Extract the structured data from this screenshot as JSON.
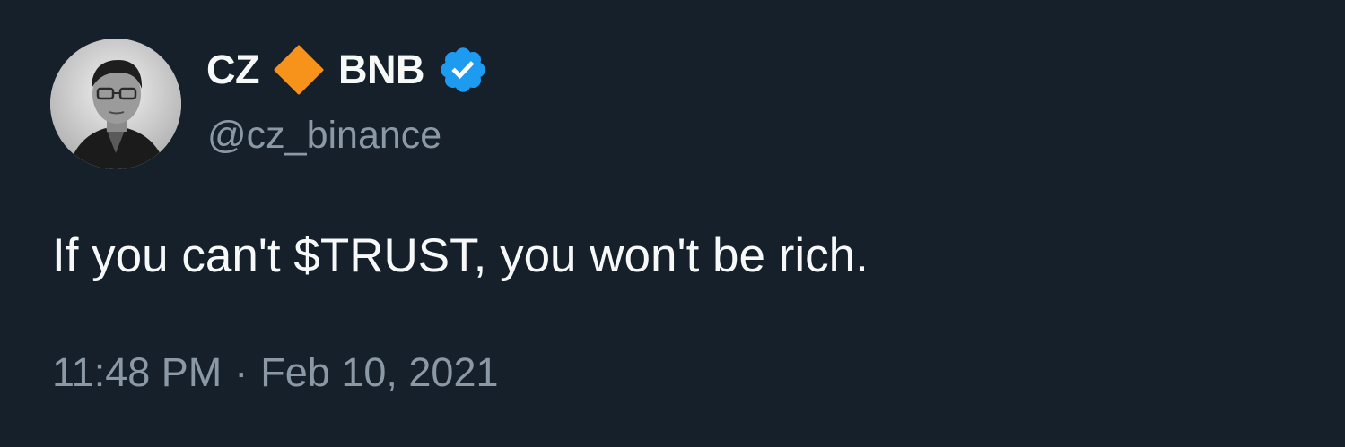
{
  "tweet": {
    "author": {
      "display_name_prefix": "CZ",
      "display_name_suffix": "BNB",
      "handle": "@cz_binance",
      "avatar_icon": "profile-photo",
      "name_emoji_icon": "orange-diamond-icon",
      "verified_icon": "verified-badge-icon"
    },
    "text": "If you can't $TRUST, you won't be rich.",
    "time": "11:48 PM",
    "separator": "·",
    "date": "Feb 10, 2021"
  },
  "colors": {
    "background": "#15202b",
    "primary_text": "#f7f9f9",
    "secondary_text": "#8b98a5",
    "diamond": "#f7931a",
    "verified": "#1d9bf0"
  }
}
